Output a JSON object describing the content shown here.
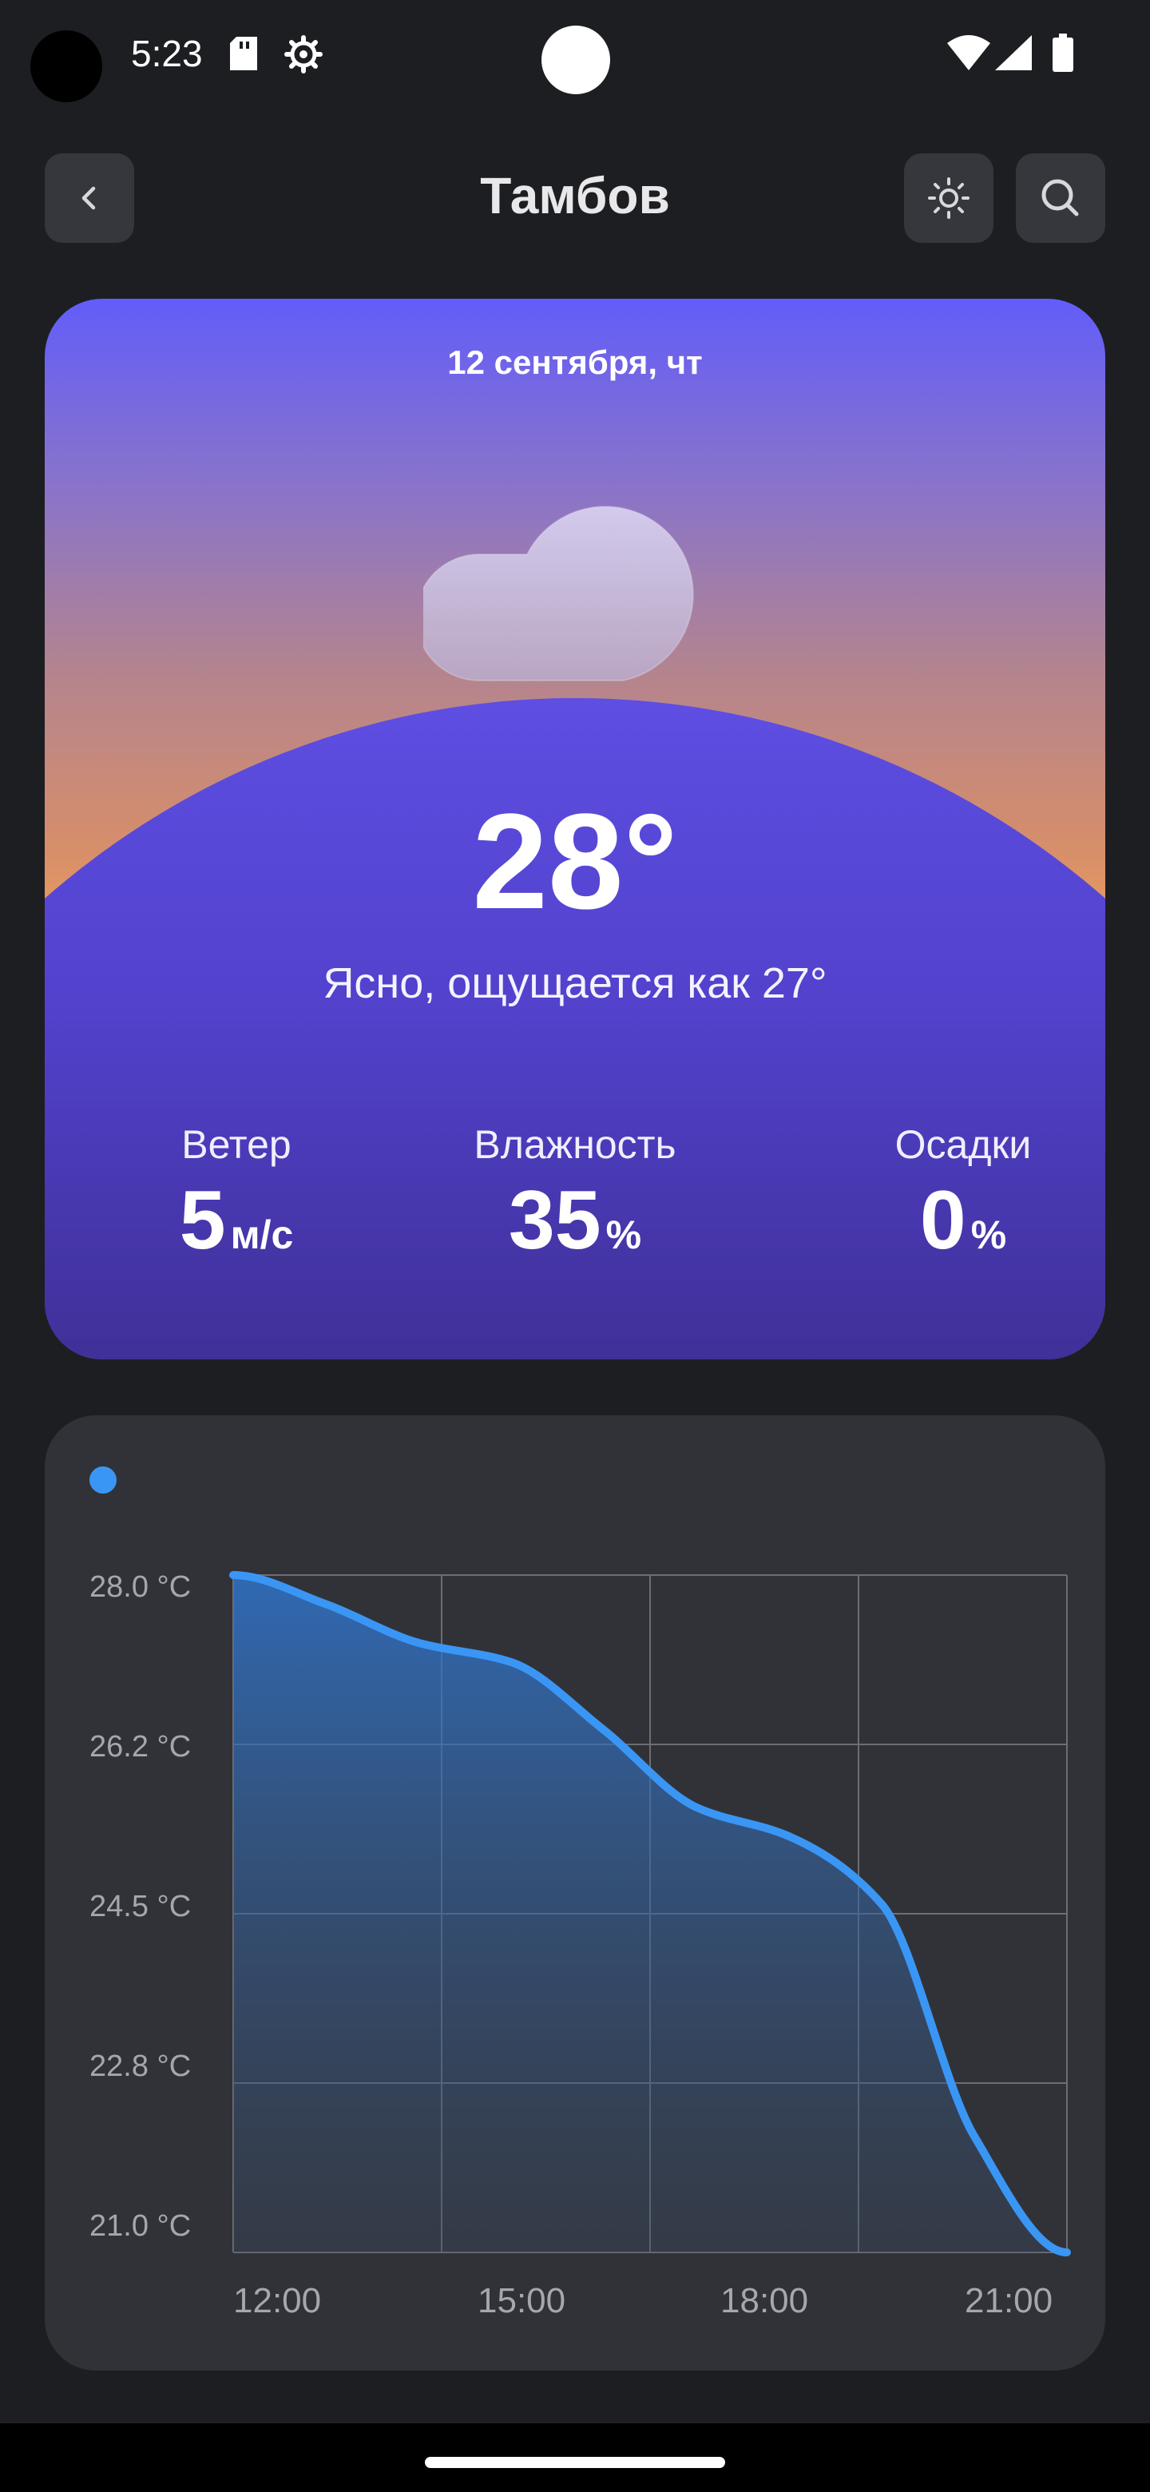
{
  "status_bar": {
    "time": "5:23"
  },
  "header": {
    "title": "Тамбов"
  },
  "weather": {
    "date": "12 сентября, чт",
    "temperature": "28°",
    "summary": "Ясно, ощущается как 27°",
    "stats": [
      {
        "label": "Ветер",
        "value": "5",
        "unit": "м/с"
      },
      {
        "label": "Влажность",
        "value": "35",
        "unit": "%"
      },
      {
        "label": "Осадки",
        "value": "0",
        "unit": "%"
      }
    ]
  },
  "chart_data": {
    "type": "area",
    "series": [
      {
        "color": "#3a96f5",
        "x": [
          "12:00",
          "13:00",
          "14:00",
          "15:00",
          "16:00",
          "17:00",
          "18:00",
          "19:00",
          "20:00",
          "21:00"
        ],
        "values": [
          28.0,
          27.7,
          27.3,
          27.1,
          26.4,
          25.6,
          25.3,
          24.6,
          22.2,
          21.0
        ]
      }
    ],
    "x_ticks": [
      "12:00",
      "15:00",
      "18:00",
      "21:00"
    ],
    "y_ticks": [
      "28.0 °C",
      "26.2 °C",
      "24.5 °C",
      "22.8 °C",
      "21.0 °C"
    ],
    "ylim": [
      21.0,
      28.0
    ],
    "grid": true,
    "line_color": "#3a96f5"
  }
}
